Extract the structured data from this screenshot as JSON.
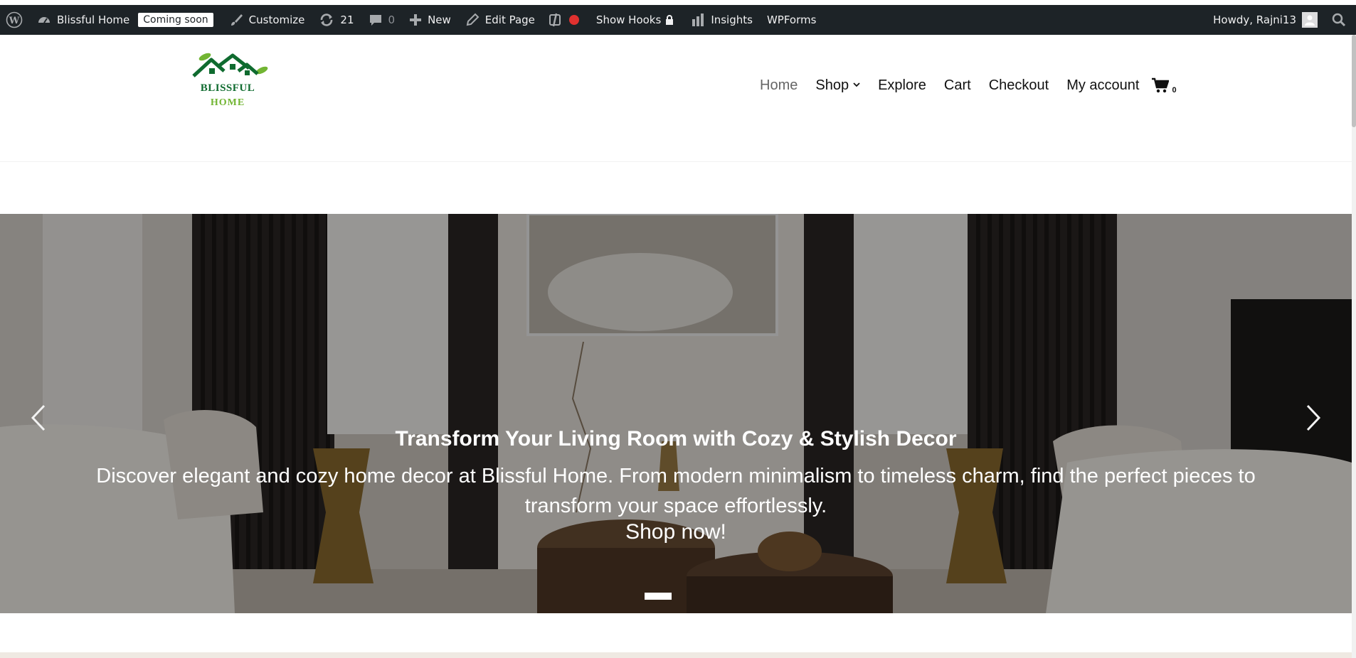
{
  "adminbar": {
    "site_name": "Blissful Home",
    "coming_soon": "Coming soon",
    "customize": "Customize",
    "updates_count": "21",
    "comments_count": "0",
    "new": "New",
    "edit_page": "Edit Page",
    "show_hooks": "Show Hooks",
    "insights": "Insights",
    "wpforms": "WPForms",
    "howdy": "Howdy, Rajni13"
  },
  "logo": {
    "line1": "BLISSFUL",
    "line2": "HOME"
  },
  "nav": {
    "home": "Home",
    "shop": "Shop",
    "explore": "Explore",
    "cart": "Cart",
    "checkout": "Checkout",
    "my_account": "My account",
    "cart_count": "0"
  },
  "hero": {
    "title": "Transform Your Living Room with Cozy & Stylish Decor",
    "description": "Discover elegant and cozy home decor at Blissful Home. From modern minimalism to timeless charm, find the perfect pieces to transform your space effortlessly.",
    "cta": "Shop now!"
  },
  "colors": {
    "adminbar_bg": "#1d2327",
    "logo_green": "#0f6b2f",
    "logo_light_green": "#72b533",
    "record_dot": "#e0312f"
  }
}
